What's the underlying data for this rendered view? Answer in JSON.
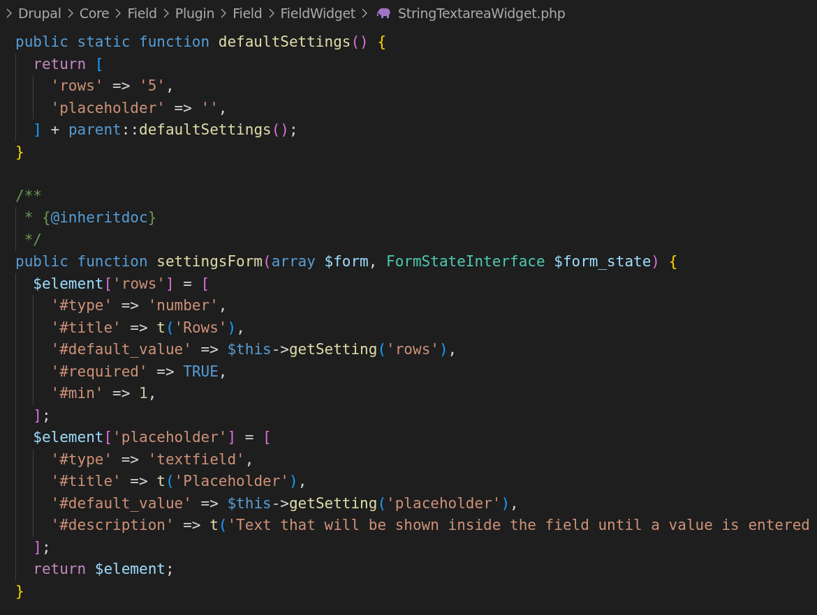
{
  "breadcrumb": {
    "folders": [
      "Drupal",
      "Core",
      "Field",
      "Plugin",
      "Field",
      "FieldWidget"
    ],
    "file": "StringTextareaWidget.php"
  },
  "code_lines": [
    {
      "kind": "code",
      "tokens": [
        {
          "text": "public static function ",
          "kind": "kw"
        },
        {
          "text": "defaultSettings",
          "kind": "fn"
        },
        {
          "text": "() ",
          "kind": "br2"
        },
        {
          "text": "{",
          "kind": "br1"
        }
      ]
    },
    {
      "kind": "code",
      "tokens": [
        {
          "text": "  return ",
          "kind": "ctrl"
        },
        {
          "text": "[",
          "kind": "br3"
        }
      ]
    },
    {
      "kind": "code",
      "tokens": [
        {
          "text": "    'rows'",
          "kind": "str"
        },
        {
          "text": " => ",
          "kind": "punc"
        },
        {
          "text": "'5'",
          "kind": "str"
        },
        {
          "text": ",",
          "kind": "punc"
        }
      ]
    },
    {
      "kind": "code",
      "tokens": [
        {
          "text": "    'placeholder'",
          "kind": "str"
        },
        {
          "text": " => ",
          "kind": "punc"
        },
        {
          "text": "''",
          "kind": "str"
        },
        {
          "text": ",",
          "kind": "punc"
        }
      ]
    },
    {
      "kind": "code",
      "tokens": [
        {
          "text": "  ]",
          "kind": "br3"
        },
        {
          "text": " + ",
          "kind": "punc"
        },
        {
          "text": "parent",
          "kind": "kw"
        },
        {
          "text": "::",
          "kind": "punc"
        },
        {
          "text": "defaultSettings",
          "kind": "fn"
        },
        {
          "text": "()",
          "kind": "br2"
        },
        {
          "text": ";",
          "kind": "punc"
        }
      ]
    },
    {
      "kind": "code",
      "tokens": [
        {
          "text": "}",
          "kind": "br1"
        }
      ]
    },
    {
      "kind": "blank"
    },
    {
      "kind": "code",
      "tokens": [
        {
          "text": "/**",
          "kind": "cmt"
        }
      ]
    },
    {
      "kind": "code",
      "tokens": [
        {
          "text": " * {",
          "kind": "cmt"
        },
        {
          "text": "@inheritdoc",
          "kind": "kw"
        },
        {
          "text": "}",
          "kind": "cmt"
        }
      ]
    },
    {
      "kind": "code",
      "tokens": [
        {
          "text": " */",
          "kind": "cmt"
        }
      ]
    },
    {
      "kind": "code",
      "tokens": [
        {
          "text": "public function ",
          "kind": "kw"
        },
        {
          "text": "settingsForm",
          "kind": "fn"
        },
        {
          "text": "(",
          "kind": "br2"
        },
        {
          "text": "array ",
          "kind": "kw"
        },
        {
          "text": "$form",
          "kind": "var"
        },
        {
          "text": ", ",
          "kind": "punc"
        },
        {
          "text": "FormStateInterface ",
          "kind": "cls"
        },
        {
          "text": "$form_state",
          "kind": "var"
        },
        {
          "text": ") ",
          "kind": "br2"
        },
        {
          "text": "{",
          "kind": "br1"
        }
      ]
    },
    {
      "kind": "code",
      "tokens": [
        {
          "text": "  $element",
          "kind": "var"
        },
        {
          "text": "[",
          "kind": "br2"
        },
        {
          "text": "'rows'",
          "kind": "str"
        },
        {
          "text": "]",
          "kind": "br2"
        },
        {
          "text": " = ",
          "kind": "punc"
        },
        {
          "text": "[",
          "kind": "br2"
        }
      ]
    },
    {
      "kind": "code",
      "tokens": [
        {
          "text": "    '#type'",
          "kind": "str"
        },
        {
          "text": " => ",
          "kind": "punc"
        },
        {
          "text": "'number'",
          "kind": "str"
        },
        {
          "text": ",",
          "kind": "punc"
        }
      ]
    },
    {
      "kind": "code",
      "tokens": [
        {
          "text": "    '#title'",
          "kind": "str"
        },
        {
          "text": " => ",
          "kind": "punc"
        },
        {
          "text": "t",
          "kind": "fn"
        },
        {
          "text": "(",
          "kind": "br3"
        },
        {
          "text": "'Rows'",
          "kind": "str"
        },
        {
          "text": ")",
          "kind": "br3"
        },
        {
          "text": ",",
          "kind": "punc"
        }
      ]
    },
    {
      "kind": "code",
      "tokens": [
        {
          "text": "    '#default_value'",
          "kind": "str"
        },
        {
          "text": " => ",
          "kind": "punc"
        },
        {
          "text": "$this",
          "kind": "kw"
        },
        {
          "text": "->",
          "kind": "punc"
        },
        {
          "text": "getSetting",
          "kind": "fn"
        },
        {
          "text": "(",
          "kind": "br3"
        },
        {
          "text": "'rows'",
          "kind": "str"
        },
        {
          "text": ")",
          "kind": "br3"
        },
        {
          "text": ",",
          "kind": "punc"
        }
      ]
    },
    {
      "kind": "code",
      "tokens": [
        {
          "text": "    '#required'",
          "kind": "str"
        },
        {
          "text": " => ",
          "kind": "punc"
        },
        {
          "text": "TRUE",
          "kind": "kw"
        },
        {
          "text": ",",
          "kind": "punc"
        }
      ]
    },
    {
      "kind": "code",
      "tokens": [
        {
          "text": "    '#min'",
          "kind": "str"
        },
        {
          "text": " => ",
          "kind": "punc"
        },
        {
          "text": "1",
          "kind": "num"
        },
        {
          "text": ",",
          "kind": "punc"
        }
      ]
    },
    {
      "kind": "code",
      "tokens": [
        {
          "text": "  ]",
          "kind": "br2"
        },
        {
          "text": ";",
          "kind": "punc"
        }
      ]
    },
    {
      "kind": "code",
      "tokens": [
        {
          "text": "  $element",
          "kind": "var"
        },
        {
          "text": "[",
          "kind": "br2"
        },
        {
          "text": "'placeholder'",
          "kind": "str"
        },
        {
          "text": "]",
          "kind": "br2"
        },
        {
          "text": " = ",
          "kind": "punc"
        },
        {
          "text": "[",
          "kind": "br2"
        }
      ]
    },
    {
      "kind": "code",
      "tokens": [
        {
          "text": "    '#type'",
          "kind": "str"
        },
        {
          "text": " => ",
          "kind": "punc"
        },
        {
          "text": "'textfield'",
          "kind": "str"
        },
        {
          "text": ",",
          "kind": "punc"
        }
      ]
    },
    {
      "kind": "code",
      "tokens": [
        {
          "text": "    '#title'",
          "kind": "str"
        },
        {
          "text": " => ",
          "kind": "punc"
        },
        {
          "text": "t",
          "kind": "fn"
        },
        {
          "text": "(",
          "kind": "br3"
        },
        {
          "text": "'Placeholder'",
          "kind": "str"
        },
        {
          "text": ")",
          "kind": "br3"
        },
        {
          "text": ",",
          "kind": "punc"
        }
      ]
    },
    {
      "kind": "code",
      "tokens": [
        {
          "text": "    '#default_value'",
          "kind": "str"
        },
        {
          "text": " => ",
          "kind": "punc"
        },
        {
          "text": "$this",
          "kind": "kw"
        },
        {
          "text": "->",
          "kind": "punc"
        },
        {
          "text": "getSetting",
          "kind": "fn"
        },
        {
          "text": "(",
          "kind": "br3"
        },
        {
          "text": "'placeholder'",
          "kind": "str"
        },
        {
          "text": ")",
          "kind": "br3"
        },
        {
          "text": ",",
          "kind": "punc"
        }
      ]
    },
    {
      "kind": "code",
      "tokens": [
        {
          "text": "    '#description'",
          "kind": "str"
        },
        {
          "text": " => ",
          "kind": "punc"
        },
        {
          "text": "t",
          "kind": "fn"
        },
        {
          "text": "(",
          "kind": "br3"
        },
        {
          "text": "'Text that will be shown inside the field until a value is entered",
          "kind": "str"
        }
      ]
    },
    {
      "kind": "code",
      "tokens": [
        {
          "text": "  ]",
          "kind": "br2"
        },
        {
          "text": ";",
          "kind": "punc"
        }
      ]
    },
    {
      "kind": "code",
      "tokens": [
        {
          "text": "  return ",
          "kind": "ctrl"
        },
        {
          "text": "$element",
          "kind": "var"
        },
        {
          "text": ";",
          "kind": "punc"
        }
      ]
    },
    {
      "kind": "code",
      "tokens": [
        {
          "text": "}",
          "kind": "br1"
        }
      ]
    }
  ]
}
